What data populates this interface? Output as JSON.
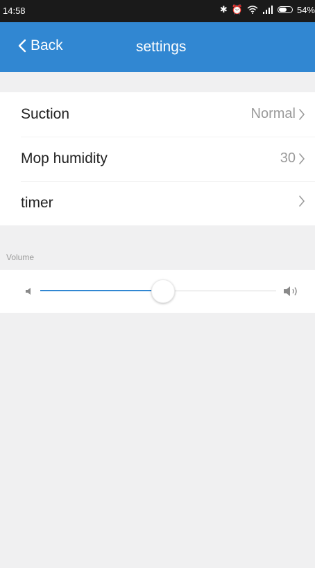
{
  "status_bar": {
    "time": "14:58",
    "battery_text": "54%",
    "icons": [
      "bluetooth-icon",
      "alarm-icon",
      "wifi-icon",
      "signal-icon",
      "battery-icon"
    ]
  },
  "nav": {
    "back_label": "Back",
    "title": "settings",
    "background_color": "#3187d2"
  },
  "settings": {
    "rows": [
      {
        "label": "Suction",
        "value": "Normal"
      },
      {
        "label": "Mop humidity",
        "value": "30"
      },
      {
        "label": "timer",
        "value": ""
      }
    ]
  },
  "volume": {
    "section_label": "Volume",
    "level": 0.52,
    "accent_color": "#3187d2"
  }
}
